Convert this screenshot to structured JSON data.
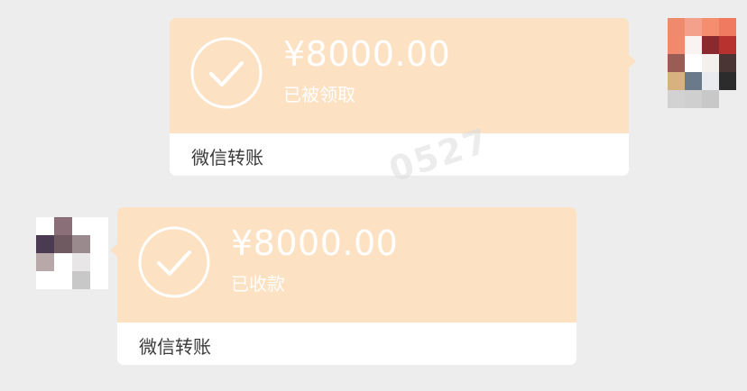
{
  "messages": [
    {
      "side": "right",
      "amount": "¥8000.00",
      "status": "已被领取",
      "footer": "微信转账",
      "icon": "check-circle-icon"
    },
    {
      "side": "left",
      "amount": "¥8000.00",
      "status": "已收款",
      "footer": "微信转账",
      "icon": "check-circle-icon"
    }
  ],
  "watermark": "0527",
  "colors": {
    "background": "#ededed",
    "card_top": "#fde1c3",
    "card_bottom": "#ffffff",
    "text_on_card": "#ffffff",
    "footer_text": "#3a3a3a"
  }
}
